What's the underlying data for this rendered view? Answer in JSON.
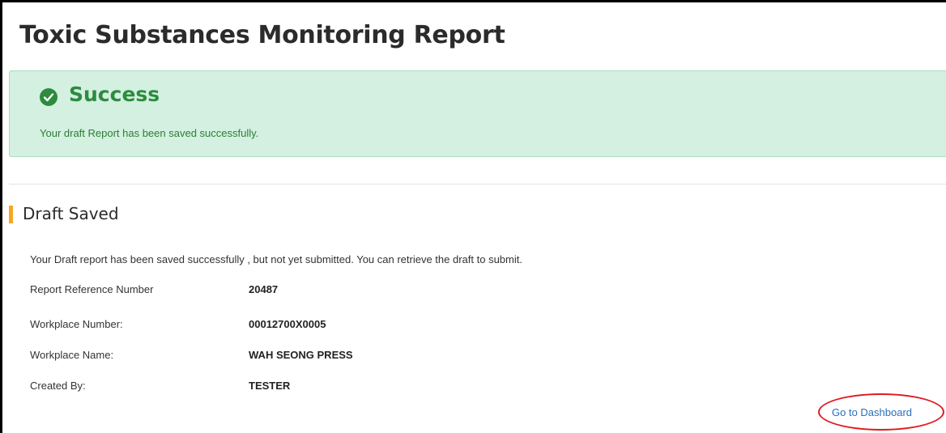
{
  "page": {
    "title": "Toxic Substances Monitoring Report"
  },
  "alert": {
    "icon": "check-circle-icon",
    "title": "Success",
    "message": "Your draft Report has been saved successfully.",
    "color": "#2e8b3e",
    "background": "#d3f0e1"
  },
  "section": {
    "title": "Draft Saved",
    "accent": "#f5a623",
    "intro": "Your Draft report has been saved successfully , but not yet submitted. You can retrieve the draft to submit."
  },
  "details": [
    {
      "label": "Report Reference Number",
      "value": "20487"
    },
    {
      "label": "Workplace Number:",
      "value": "00012700X0005"
    },
    {
      "label": "Workplace Name:",
      "value": "WAH SEONG PRESS"
    },
    {
      "label": "Created By:",
      "value": "TESTER"
    }
  ],
  "actions": {
    "dashboard_link": "Go to Dashboard",
    "highlight_color": "#e0191f"
  }
}
